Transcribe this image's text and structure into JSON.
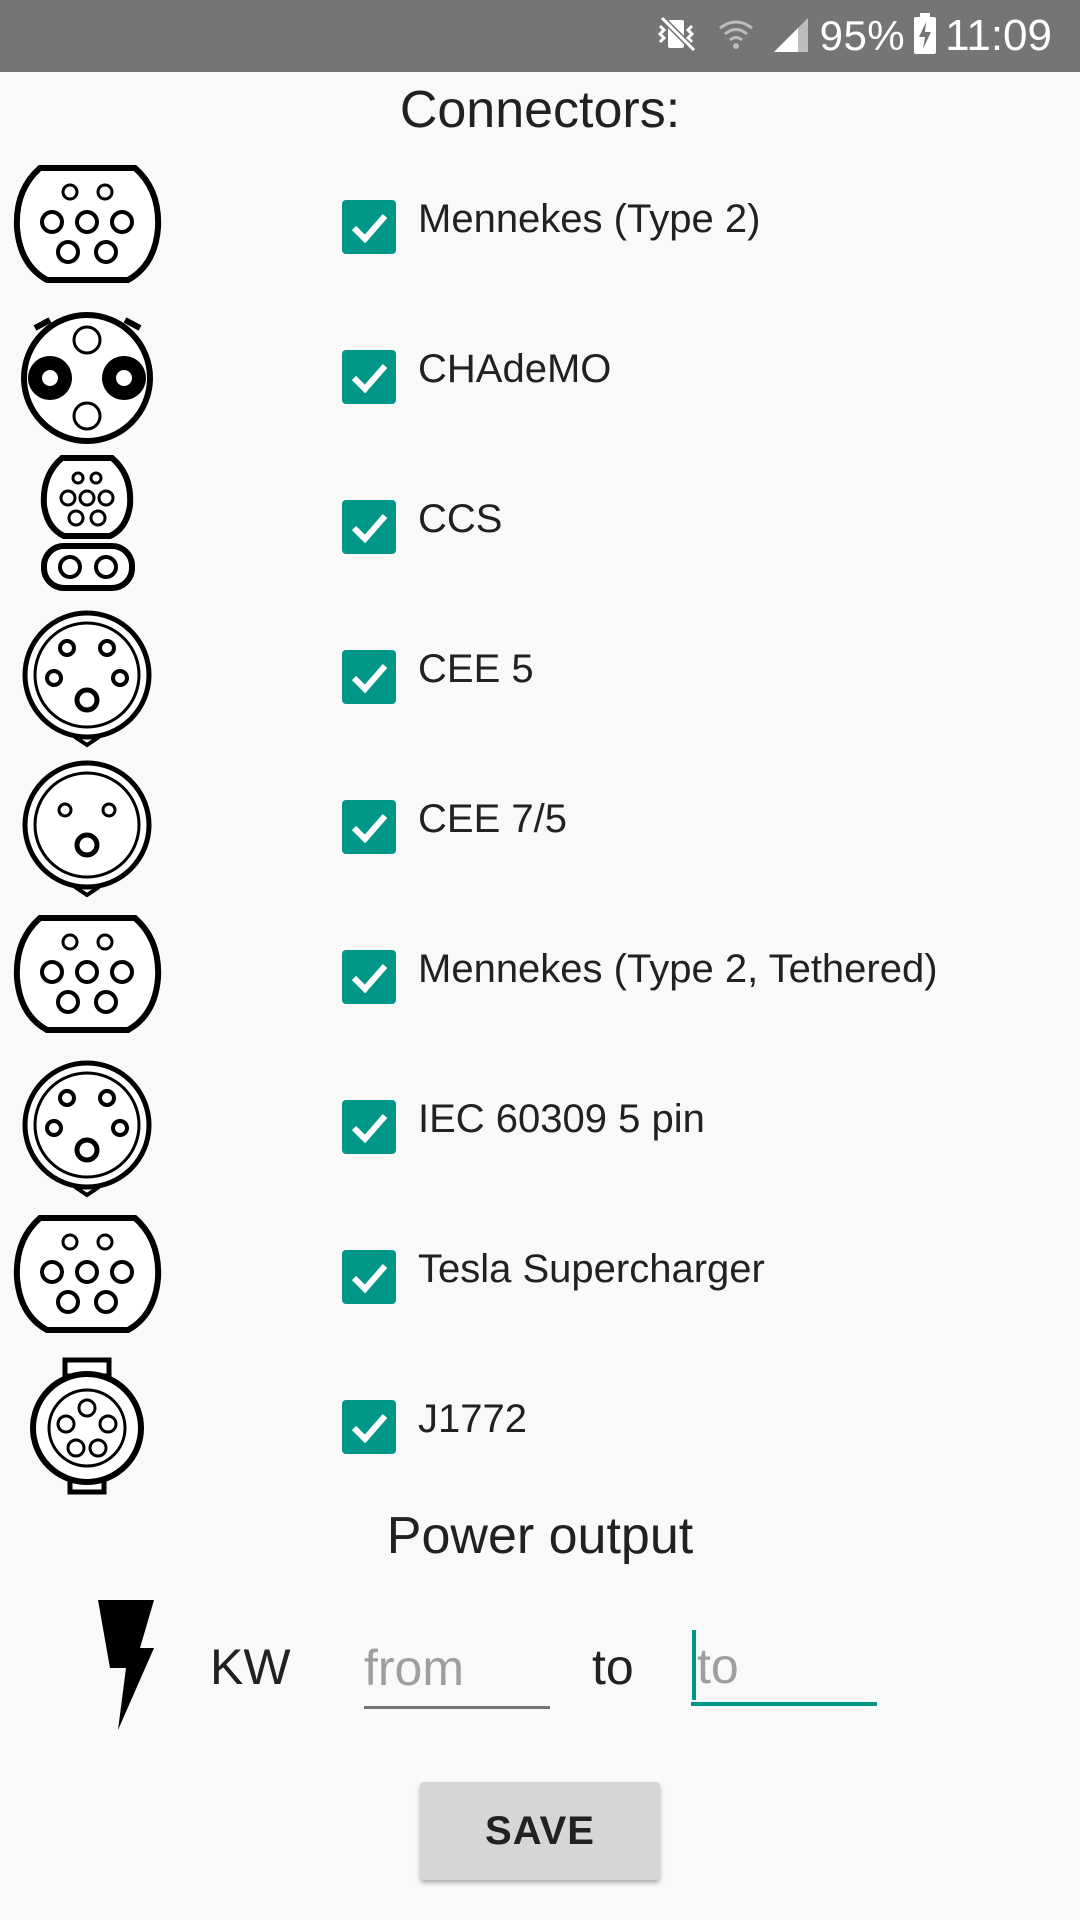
{
  "status_bar": {
    "battery": "95%",
    "time": "11:09",
    "icons": [
      "mute-vibrate-icon",
      "wifi-icon",
      "signal-icon",
      "battery-charging-icon"
    ]
  },
  "connectors_title": "Connectors:",
  "connectors": [
    {
      "label": "Mennekes (Type 2)",
      "checked": true,
      "icon": "type2-plug-icon"
    },
    {
      "label": "CHAdeMO",
      "checked": true,
      "icon": "chademo-plug-icon"
    },
    {
      "label": "CCS",
      "checked": true,
      "icon": "ccs-plug-icon"
    },
    {
      "label": "CEE 5",
      "checked": true,
      "icon": "cee5-plug-icon"
    },
    {
      "label": "CEE 7/5",
      "checked": true,
      "icon": "cee75-plug-icon"
    },
    {
      "label": "Mennekes (Type 2, Tethered)",
      "checked": true,
      "icon": "type2-plug-icon"
    },
    {
      "label": "IEC 60309 5 pin",
      "checked": true,
      "icon": "iec60309-plug-icon"
    },
    {
      "label": "Tesla Supercharger",
      "checked": true,
      "icon": "type2-plug-icon"
    },
    {
      "label": "J1772",
      "checked": true,
      "icon": "j1772-plug-icon"
    }
  ],
  "power": {
    "title": "Power output",
    "unit": "KW",
    "from_placeholder": "from",
    "from_value": "",
    "to_label": "to",
    "to_placeholder": "to",
    "to_value": ""
  },
  "save_label": "SAVE",
  "colors": {
    "accent": "#009688",
    "status_bar": "#757575",
    "background": "#f9f9f9",
    "button": "#d6d6d6"
  }
}
